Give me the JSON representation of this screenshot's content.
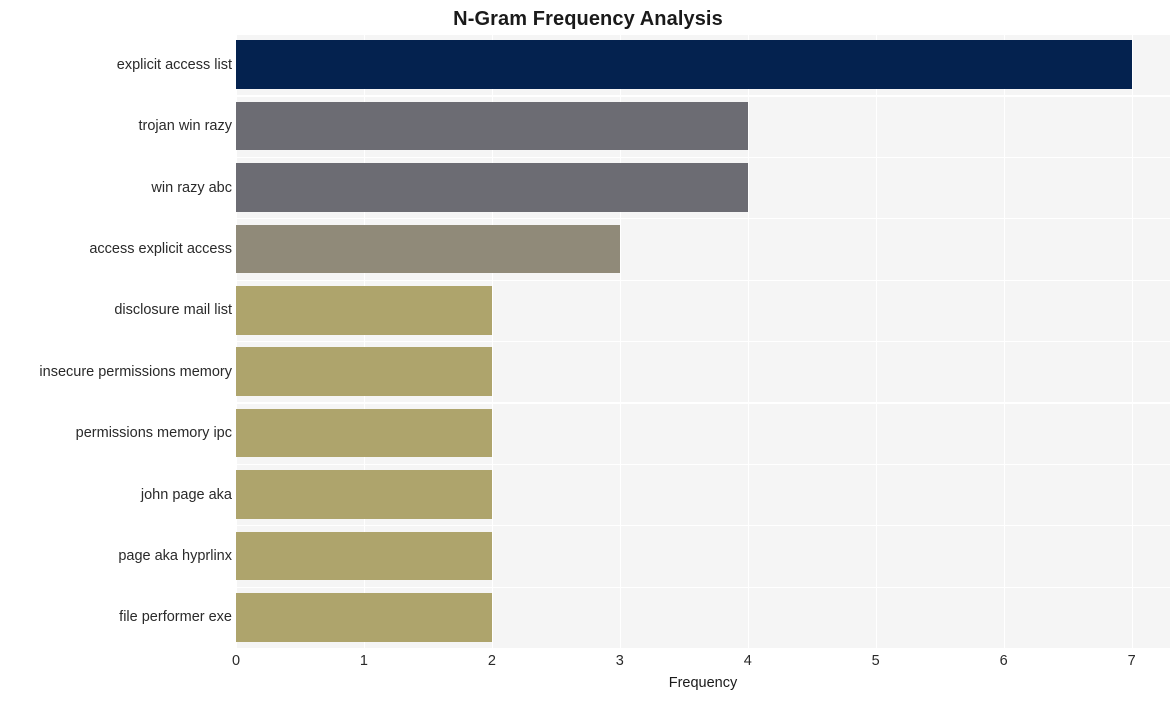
{
  "chart_data": {
    "type": "bar",
    "orientation": "horizontal",
    "title": "N-Gram Frequency Analysis",
    "xlabel": "Frequency",
    "ylabel": "",
    "categories": [
      "explicit access list",
      "trojan win razy",
      "win razy abc",
      "access explicit access",
      "disclosure mail list",
      "insecure permissions memory",
      "permissions memory ipc",
      "john page aka",
      "page aka hyprlinx",
      "file performer exe"
    ],
    "values": [
      7,
      4,
      4,
      3,
      2,
      2,
      2,
      2,
      2,
      2
    ],
    "bar_colors": [
      "#04224f",
      "#6c6c73",
      "#6c6c73",
      "#908a79",
      "#aea46c",
      "#aea46c",
      "#aea46c",
      "#aea46c",
      "#aea46c",
      "#aea46c"
    ],
    "xlim": [
      0,
      7.3
    ],
    "xticks": [
      0,
      1,
      2,
      3,
      4,
      5,
      6,
      7
    ],
    "xtick_labels": [
      "0",
      "1",
      "2",
      "3",
      "4",
      "5",
      "6",
      "7"
    ],
    "grid": true,
    "grid_color": "#ffffff",
    "plot_background": "#f5f5f5",
    "figure_background": "#ffffff",
    "legend": null,
    "annotations": []
  }
}
